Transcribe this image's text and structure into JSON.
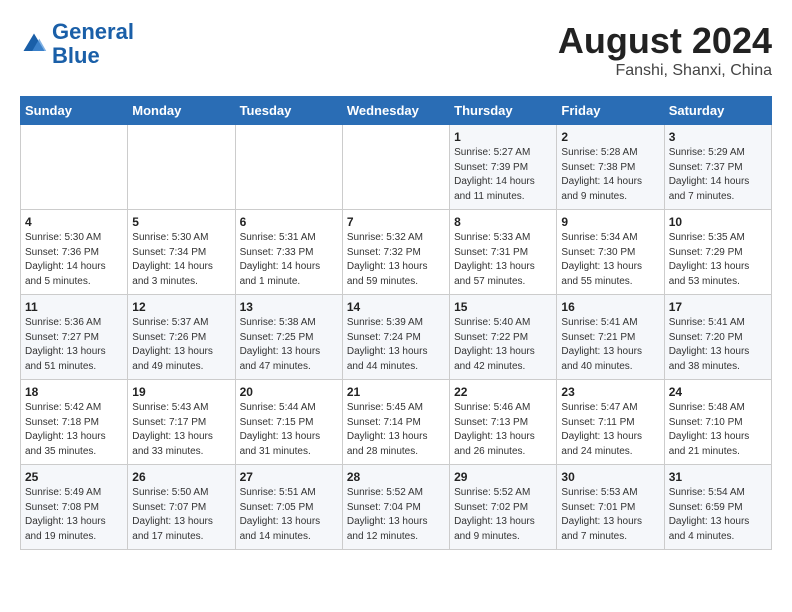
{
  "header": {
    "logo_line1": "General",
    "logo_line2": "Blue",
    "month_year": "August 2024",
    "location": "Fanshi, Shanxi, China"
  },
  "weekdays": [
    "Sunday",
    "Monday",
    "Tuesday",
    "Wednesday",
    "Thursday",
    "Friday",
    "Saturday"
  ],
  "weeks": [
    [
      {
        "day": "",
        "info": ""
      },
      {
        "day": "",
        "info": ""
      },
      {
        "day": "",
        "info": ""
      },
      {
        "day": "",
        "info": ""
      },
      {
        "day": "1",
        "info": "Sunrise: 5:27 AM\nSunset: 7:39 PM\nDaylight: 14 hours\nand 11 minutes."
      },
      {
        "day": "2",
        "info": "Sunrise: 5:28 AM\nSunset: 7:38 PM\nDaylight: 14 hours\nand 9 minutes."
      },
      {
        "day": "3",
        "info": "Sunrise: 5:29 AM\nSunset: 7:37 PM\nDaylight: 14 hours\nand 7 minutes."
      }
    ],
    [
      {
        "day": "4",
        "info": "Sunrise: 5:30 AM\nSunset: 7:36 PM\nDaylight: 14 hours\nand 5 minutes."
      },
      {
        "day": "5",
        "info": "Sunrise: 5:30 AM\nSunset: 7:34 PM\nDaylight: 14 hours\nand 3 minutes."
      },
      {
        "day": "6",
        "info": "Sunrise: 5:31 AM\nSunset: 7:33 PM\nDaylight: 14 hours\nand 1 minute."
      },
      {
        "day": "7",
        "info": "Sunrise: 5:32 AM\nSunset: 7:32 PM\nDaylight: 13 hours\nand 59 minutes."
      },
      {
        "day": "8",
        "info": "Sunrise: 5:33 AM\nSunset: 7:31 PM\nDaylight: 13 hours\nand 57 minutes."
      },
      {
        "day": "9",
        "info": "Sunrise: 5:34 AM\nSunset: 7:30 PM\nDaylight: 13 hours\nand 55 minutes."
      },
      {
        "day": "10",
        "info": "Sunrise: 5:35 AM\nSunset: 7:29 PM\nDaylight: 13 hours\nand 53 minutes."
      }
    ],
    [
      {
        "day": "11",
        "info": "Sunrise: 5:36 AM\nSunset: 7:27 PM\nDaylight: 13 hours\nand 51 minutes."
      },
      {
        "day": "12",
        "info": "Sunrise: 5:37 AM\nSunset: 7:26 PM\nDaylight: 13 hours\nand 49 minutes."
      },
      {
        "day": "13",
        "info": "Sunrise: 5:38 AM\nSunset: 7:25 PM\nDaylight: 13 hours\nand 47 minutes."
      },
      {
        "day": "14",
        "info": "Sunrise: 5:39 AM\nSunset: 7:24 PM\nDaylight: 13 hours\nand 44 minutes."
      },
      {
        "day": "15",
        "info": "Sunrise: 5:40 AM\nSunset: 7:22 PM\nDaylight: 13 hours\nand 42 minutes."
      },
      {
        "day": "16",
        "info": "Sunrise: 5:41 AM\nSunset: 7:21 PM\nDaylight: 13 hours\nand 40 minutes."
      },
      {
        "day": "17",
        "info": "Sunrise: 5:41 AM\nSunset: 7:20 PM\nDaylight: 13 hours\nand 38 minutes."
      }
    ],
    [
      {
        "day": "18",
        "info": "Sunrise: 5:42 AM\nSunset: 7:18 PM\nDaylight: 13 hours\nand 35 minutes."
      },
      {
        "day": "19",
        "info": "Sunrise: 5:43 AM\nSunset: 7:17 PM\nDaylight: 13 hours\nand 33 minutes."
      },
      {
        "day": "20",
        "info": "Sunrise: 5:44 AM\nSunset: 7:15 PM\nDaylight: 13 hours\nand 31 minutes."
      },
      {
        "day": "21",
        "info": "Sunrise: 5:45 AM\nSunset: 7:14 PM\nDaylight: 13 hours\nand 28 minutes."
      },
      {
        "day": "22",
        "info": "Sunrise: 5:46 AM\nSunset: 7:13 PM\nDaylight: 13 hours\nand 26 minutes."
      },
      {
        "day": "23",
        "info": "Sunrise: 5:47 AM\nSunset: 7:11 PM\nDaylight: 13 hours\nand 24 minutes."
      },
      {
        "day": "24",
        "info": "Sunrise: 5:48 AM\nSunset: 7:10 PM\nDaylight: 13 hours\nand 21 minutes."
      }
    ],
    [
      {
        "day": "25",
        "info": "Sunrise: 5:49 AM\nSunset: 7:08 PM\nDaylight: 13 hours\nand 19 minutes."
      },
      {
        "day": "26",
        "info": "Sunrise: 5:50 AM\nSunset: 7:07 PM\nDaylight: 13 hours\nand 17 minutes."
      },
      {
        "day": "27",
        "info": "Sunrise: 5:51 AM\nSunset: 7:05 PM\nDaylight: 13 hours\nand 14 minutes."
      },
      {
        "day": "28",
        "info": "Sunrise: 5:52 AM\nSunset: 7:04 PM\nDaylight: 13 hours\nand 12 minutes."
      },
      {
        "day": "29",
        "info": "Sunrise: 5:52 AM\nSunset: 7:02 PM\nDaylight: 13 hours\nand 9 minutes."
      },
      {
        "day": "30",
        "info": "Sunrise: 5:53 AM\nSunset: 7:01 PM\nDaylight: 13 hours\nand 7 minutes."
      },
      {
        "day": "31",
        "info": "Sunrise: 5:54 AM\nSunset: 6:59 PM\nDaylight: 13 hours\nand 4 minutes."
      }
    ]
  ]
}
